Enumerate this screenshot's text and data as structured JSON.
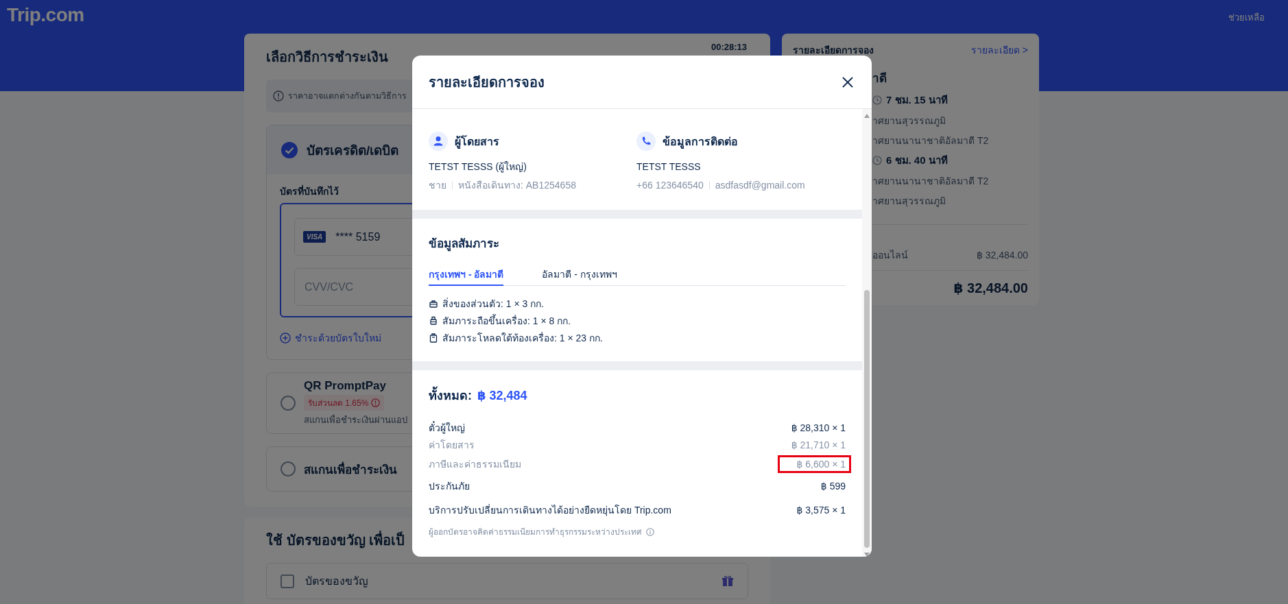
{
  "header": {
    "logo": "Trip.com",
    "help": "ช่วยเหลือ"
  },
  "payment": {
    "title": "เลือกวิธีการชำระเงิน",
    "timer": "00:28:13",
    "notice": "ราคาอาจแตกต่างกันตามวิธีการ",
    "methods": [
      {
        "kind": "card",
        "label": "บัตรเครดิต/เดบิต",
        "selected": true,
        "saved_label": "บัตรที่บันทึกไว้",
        "saved_card": {
          "brand": "VISA",
          "number": "**** 5159"
        },
        "cvv": {
          "placeholder": "CVV/CVC"
        },
        "new_card": "ชำระด้วยบัตรใบใหม่"
      },
      {
        "kind": "qr",
        "label": "QR PromptPay",
        "selected": false,
        "badge": "รับส่วนลด 1.65%",
        "description": "สแกนเพื่อชำระเงินผ่านแอป"
      },
      {
        "kind": "scan",
        "label": "สแกนเพื่อชำระเงิน",
        "selected": false
      }
    ]
  },
  "gift": {
    "title": "ใช้ บัตรของขวัญ เพื่อเป็",
    "option": {
      "label": "บัตรของขวัญ",
      "checked": false
    }
  },
  "summary": {
    "title": "รายละเอียดการจอง",
    "link": "รายละเอียด >",
    "route": "าตี",
    "legs": [
      {
        "duration": "7 ชม. 15 นาที",
        "from": "าศยานสุวรรณภูมิ",
        "to": "าศยานนานาชาติอัลมาตี T2"
      },
      {
        "duration": "6 ชม. 40 นาที",
        "from": "าศยานนานาชาติอัลมาตี T2",
        "to": "าศยานสุวรรณภูมิ"
      }
    ],
    "online_label": "ออนไลน์",
    "online_amount": "฿ 32,484.00",
    "total": "฿ 32,484.00"
  },
  "modal": {
    "title": "รายละเอียดการจอง",
    "passenger": {
      "heading": "ผู้โดยสาร",
      "name": "TETST TESSS (ผู้ใหญ่)",
      "gender": "ชาย",
      "passport": "หนังสือเดินทาง: AB1254658"
    },
    "contact": {
      "heading": "ข้อมูลการติดต่อ",
      "name": "TETST TESSS",
      "phone": "+66 123646540",
      "email": "asdfasdf@gmail.com"
    },
    "baggage": {
      "title": "ข้อมูลสัมภาระ",
      "tabs": [
        {
          "label": "กรุงเทพฯ - อัลมาตี",
          "selected": true
        },
        {
          "label": "อัลมาตี - กรุงเทพฯ",
          "selected": false
        }
      ],
      "items": [
        {
          "kind": "personal",
          "text": "สิ่งของส่วนตัว: 1 × 3 กก."
        },
        {
          "kind": "carry_on",
          "text": "สัมภาระถือขึ้นเครื่อง: 1 × 8 กก."
        },
        {
          "kind": "checked",
          "text": "สัมภาระโหลดใต้ท้องเครื่อง: 1 × 23 กก."
        }
      ]
    },
    "price": {
      "label": "ทั้งหมด:",
      "total": "฿ 32,484",
      "rows": [
        {
          "kind": "main",
          "label": "ตั๋วผู้ใหญ่",
          "amount": "฿ 28,310 × 1",
          "highlighted": false
        },
        {
          "kind": "sub",
          "label": "ค่าโดยสาร",
          "amount": "฿ 21,710 × 1",
          "highlighted": false
        },
        {
          "kind": "sub",
          "label": "ภาษีและค่าธรรมเนียม",
          "amount": "฿ 6,600 × 1",
          "highlighted": true
        },
        {
          "kind": "main",
          "label": "ประกันภัย",
          "amount": "฿ 599",
          "highlighted": false
        },
        {
          "kind": "main",
          "label": "บริการปรับเปลี่ยนการเดินทางได้อย่างยืดหยุ่นโดย Trip.com",
          "amount": "฿ 3,575 × 1",
          "highlighted": false
        }
      ],
      "note": "ผู้ออกบัตรอาจคิดค่าธรรมเนียมการทำธุรกรรมระหว่างประเทศ"
    }
  }
}
